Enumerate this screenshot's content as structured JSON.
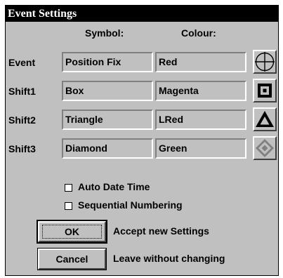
{
  "dialog": {
    "title": "Event Settings"
  },
  "headers": {
    "symbol": "Symbol:",
    "colour": "Colour:"
  },
  "rows": [
    {
      "label": "Event",
      "symbol": "Position Fix",
      "colour": "Red",
      "icon": "crosshair-circle-icon"
    },
    {
      "label": "Shift1",
      "symbol": "Box",
      "colour": "Magenta",
      "icon": "box-icon"
    },
    {
      "label": "Shift2",
      "symbol": "Triangle",
      "colour": "LRed",
      "icon": "triangle-icon"
    },
    {
      "label": "Shift3",
      "symbol": "Diamond",
      "colour": "Green",
      "icon": "diamond-icon"
    }
  ],
  "options": [
    {
      "label": "Auto Date Time",
      "checked": false
    },
    {
      "label": "Sequential Numbering",
      "checked": false
    }
  ],
  "buttons": {
    "ok": {
      "label": "OK",
      "description": "Accept new Settings"
    },
    "cancel": {
      "label": "Cancel",
      "description": "Leave without changing"
    }
  }
}
